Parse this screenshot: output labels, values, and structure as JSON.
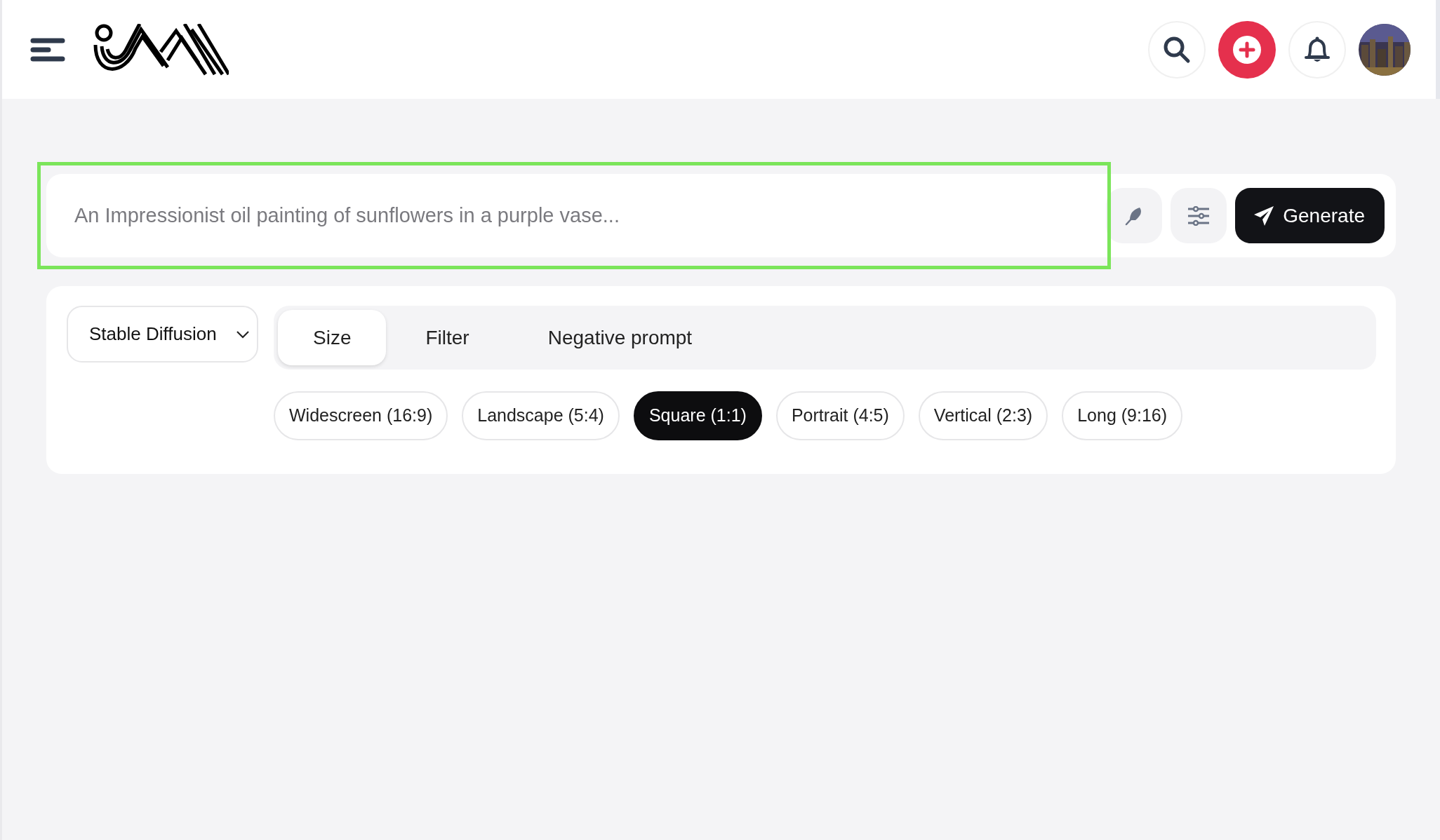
{
  "prompt": {
    "placeholder": "An Impressionist oil painting of sunflowers in a purple vase...",
    "highlighted": true,
    "generate_label": "Generate"
  },
  "model_select": {
    "value": "Stable Diffusion"
  },
  "tabs": [
    {
      "label": "Size",
      "selected": true
    },
    {
      "label": "Filter",
      "selected": false
    },
    {
      "label": "Negative prompt",
      "selected": false
    }
  ],
  "sizes": [
    {
      "label": "Widescreen (16:9)",
      "selected": false
    },
    {
      "label": "Landscape (5:4)",
      "selected": false
    },
    {
      "label": "Square (1:1)",
      "selected": true
    },
    {
      "label": "Portrait (4:5)",
      "selected": false
    },
    {
      "label": "Vertical (2:3)",
      "selected": false
    },
    {
      "label": "Long (9:16)",
      "selected": false
    }
  ]
}
